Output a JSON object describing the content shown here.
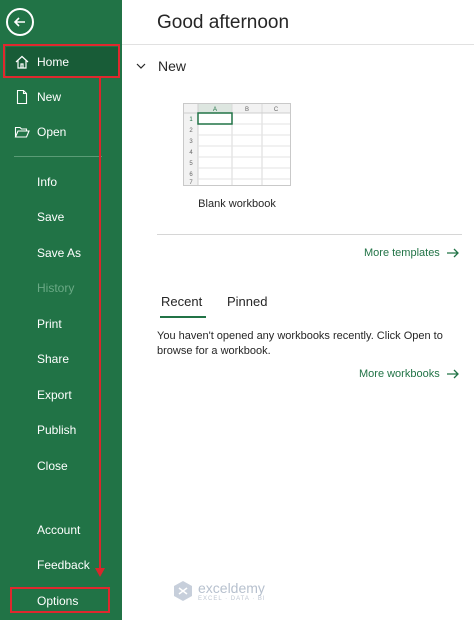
{
  "sidebar": {
    "items": [
      {
        "key": "home",
        "label": "Home",
        "icon": "home-icon",
        "state": "active"
      },
      {
        "key": "new",
        "label": "New",
        "icon": "new-document-icon"
      },
      {
        "key": "open",
        "label": "Open",
        "icon": "open-folder-icon"
      },
      {
        "key": "info",
        "label": "Info"
      },
      {
        "key": "save",
        "label": "Save"
      },
      {
        "key": "save-as",
        "label": "Save As"
      },
      {
        "key": "history",
        "label": "History",
        "state": "disabled"
      },
      {
        "key": "print",
        "label": "Print"
      },
      {
        "key": "share",
        "label": "Share"
      },
      {
        "key": "export",
        "label": "Export"
      },
      {
        "key": "publish",
        "label": "Publish"
      },
      {
        "key": "close",
        "label": "Close"
      },
      {
        "key": "account",
        "label": "Account"
      },
      {
        "key": "feedback",
        "label": "Feedback"
      },
      {
        "key": "options",
        "label": "Options"
      }
    ]
  },
  "main": {
    "greeting": "Good afternoon",
    "new_section": {
      "label": "New",
      "template": {
        "label": "Blank workbook",
        "columns": [
          "A",
          "B",
          "C"
        ],
        "rows": [
          "1",
          "2",
          "3",
          "4",
          "5",
          "6",
          "7"
        ]
      },
      "more_templates": "More templates"
    },
    "tabs": [
      {
        "label": "Recent",
        "selected": true
      },
      {
        "label": "Pinned",
        "selected": false
      }
    ],
    "recent_message": "You haven't opened any workbooks recently. Click Open to browse for a workbook.",
    "more_workbooks": "More workbooks"
  },
  "watermark": {
    "name": "exceldemy",
    "tagline": "EXCEL · DATA · BI"
  },
  "colors": {
    "sidebar_bg": "#217346",
    "sidebar_active": "#185c37",
    "accent_green": "#217346",
    "annotation_red": "#e0282e"
  }
}
